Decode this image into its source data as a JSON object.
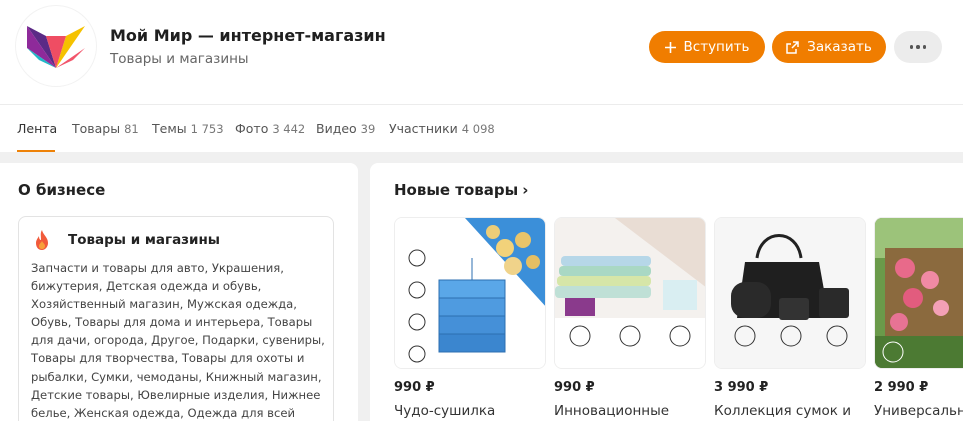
{
  "group": {
    "title": "Мой Мир — интернет-магазин",
    "subtitle": "Товары и магазины"
  },
  "actions": {
    "join_label": "Вступить",
    "order_label": "Заказать"
  },
  "tabs": [
    {
      "label": "Лента",
      "count": ""
    },
    {
      "label": "Товары",
      "count": "81"
    },
    {
      "label": "Темы",
      "count": "1 753"
    },
    {
      "label": "Фото",
      "count": "3 442"
    },
    {
      "label": "Видео",
      "count": "39"
    },
    {
      "label": "Участники",
      "count": "4 098"
    }
  ],
  "about": {
    "title": "О бизнесе",
    "card_title": "Товары и магазины",
    "description": "Запчасти и товары для авто, Украшения, бижутерия, Детская одежда и обувь, Хозяйственный магазин, Мужская одежда, Обувь, Товары для дома и интерьера, Товары для дачи, огорода, Другое, Подарки, сувениры, Товары для творчества, Товары для охоты и рыбалки, Сумки, чемоданы, Книжный магазин, Детские товары, Ювелирные изделия, Нижнее белье, Женская одежда, Одежда для всей семьи"
  },
  "new_goods": {
    "title": "Новые товары",
    "products": [
      {
        "price": "990 ₽",
        "name": "Чудо-сушилка"
      },
      {
        "price": "990 ₽",
        "name": "Инновационные"
      },
      {
        "price": "3 990 ₽",
        "name": "Коллекция сумок и"
      },
      {
        "price": "2 990 ₽",
        "name": "Универсальн"
      }
    ]
  },
  "colors": {
    "accent": "#f07d00",
    "tab_underline": "#ee8208"
  },
  "icons": {
    "join": "plus-icon",
    "order": "external-link-icon",
    "more": "more-dots-icon",
    "chevron": "chevron-right-icon",
    "card": "fire-icon"
  }
}
